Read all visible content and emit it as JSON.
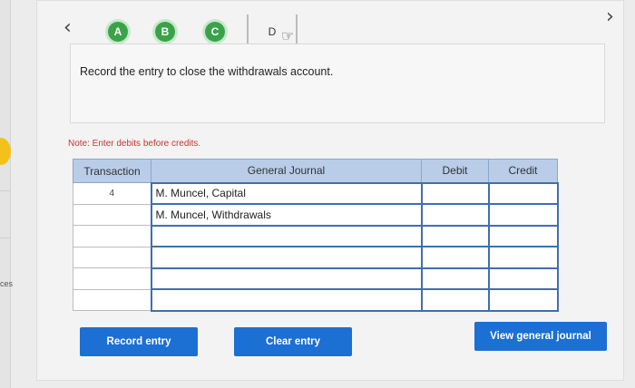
{
  "left_edge": {
    "text": "ces"
  },
  "steps": [
    "A",
    "B",
    "C",
    "D"
  ],
  "prompt": "Record the entry to close the withdrawals account.",
  "note": "Note: Enter debits before credits.",
  "journal": {
    "headers": {
      "transaction": "Transaction",
      "general_journal": "General Journal",
      "debit": "Debit",
      "credit": "Credit"
    },
    "rows": [
      {
        "transaction": "4",
        "account": "M. Muncel, Capital",
        "debit": "",
        "credit": ""
      },
      {
        "transaction": "",
        "account": "M. Muncel, Withdrawals",
        "debit": "",
        "credit": ""
      },
      {
        "transaction": "",
        "account": "",
        "debit": "",
        "credit": ""
      },
      {
        "transaction": "",
        "account": "",
        "debit": "",
        "credit": ""
      },
      {
        "transaction": "",
        "account": "",
        "debit": "",
        "credit": ""
      },
      {
        "transaction": "",
        "account": "",
        "debit": "",
        "credit": ""
      }
    ]
  },
  "buttons": {
    "record_entry": "Record entry",
    "clear_entry": "Clear entry",
    "view_general_journal": "View general journal"
  },
  "icons": {
    "prev": "chevron-left-icon",
    "next": "chevron-right-icon",
    "pointer": "hand-pointer-icon"
  },
  "colors": {
    "step_green": "#3aa34a",
    "button_blue": "#1c6fd3",
    "header_blue": "#b9cde8",
    "note_red": "#cc3333"
  }
}
